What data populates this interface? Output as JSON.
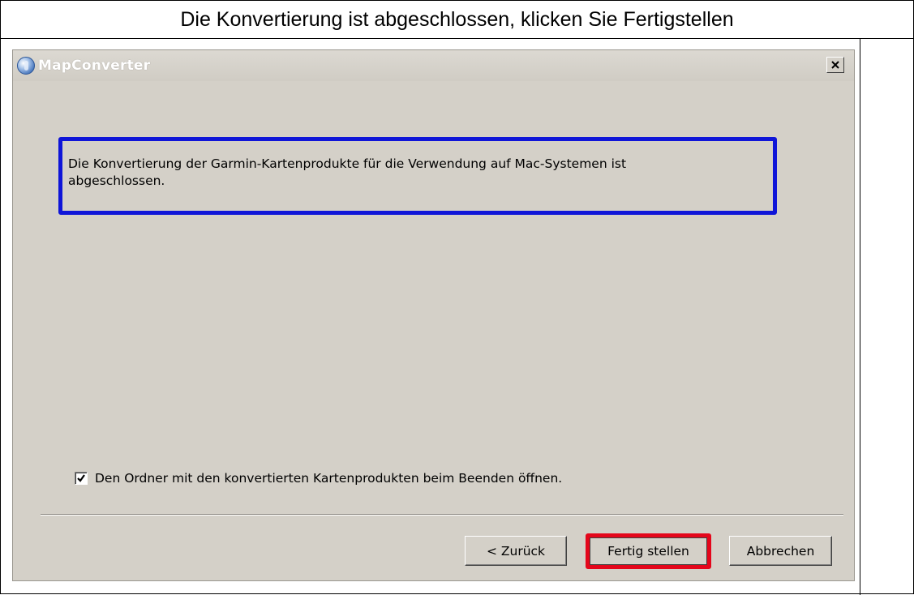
{
  "caption": {
    "text": "Die Konvertierung ist abgeschlossen, klicken Sie Fertigstellen"
  },
  "window": {
    "title": "MapConverter",
    "close_label": "×"
  },
  "message": {
    "line1": "Die Konvertierung der Garmin-Kartenprodukte für die Verwendung auf Mac-Systemen ist",
    "line2": "abgeschlossen.",
    "highlight_color": "#0f15d8"
  },
  "options": {
    "open_folder_label": "Den Ordner mit den konvertierten Kartenprodukten beim Beenden öffnen.",
    "open_folder_checked": true
  },
  "buttons": {
    "back_label": "< Zurück",
    "finish_label": "Fertig stellen",
    "cancel_label": "Abbrechen",
    "finish_highlight_color": "#e4061b"
  },
  "icons": {
    "app": "globe-icon",
    "close": "close-icon",
    "check": "checkmark-icon"
  }
}
